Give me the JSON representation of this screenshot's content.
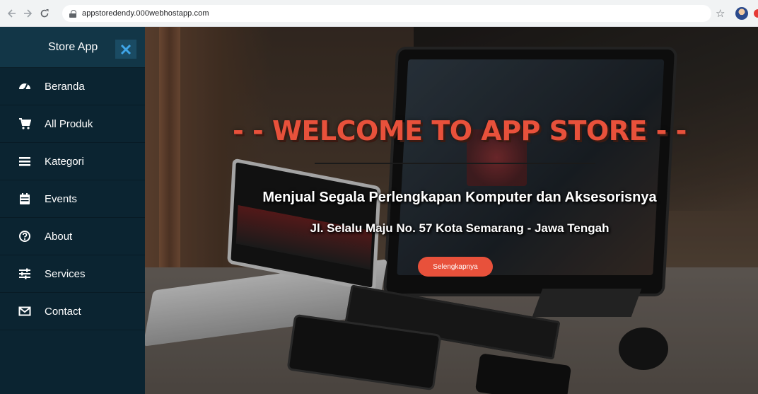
{
  "browser": {
    "url": "appstoredendy.000webhostapp.com",
    "back_icon": "arrow-left",
    "forward_icon": "arrow-right",
    "reload_icon": "reload"
  },
  "sidebar": {
    "brand": "Store App",
    "close_icon": "close-x",
    "items": [
      {
        "label": "Beranda",
        "icon": "dashboard-gauge"
      },
      {
        "label": "All Produk",
        "icon": "shopping-cart"
      },
      {
        "label": "Kategori",
        "icon": "list-bars"
      },
      {
        "label": "Events",
        "icon": "calendar"
      },
      {
        "label": "About",
        "icon": "question-circle"
      },
      {
        "label": "Services",
        "icon": "sliders"
      },
      {
        "label": "Contact",
        "icon": "envelope"
      }
    ]
  },
  "hero": {
    "title": "- - WELCOME TO APP STORE - -",
    "subtitle": "Menjual Segala Perlengkapan Komputer dan Aksesorisnya",
    "address": "Jl. Selalu Maju No. 57 Kota Semarang - Jawa Tengah",
    "button": "Selengkapnya"
  },
  "colors": {
    "accent": "#e8513b",
    "sidebar_bg": "#0b2431",
    "brand_bg": "#123647",
    "close_icon": "#3fa5e8"
  }
}
